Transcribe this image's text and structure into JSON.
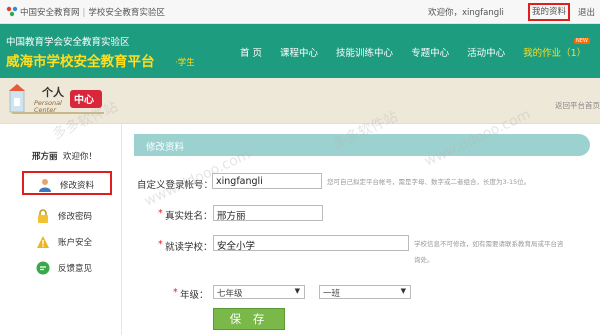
{
  "topbar": {
    "site_link": "中国安全教育网",
    "separator": "|",
    "zone_link": "学校安全教育实验区",
    "welcome": "欢迎你，xingfangli",
    "my_info": "我的资料",
    "logout": "退出"
  },
  "header": {
    "org": "中国教育学会安全教育实验区",
    "title": "威海市学校安全教育平台",
    "subtitle": "·学生",
    "nav": [
      {
        "label": "首  页"
      },
      {
        "label": "课程中心"
      },
      {
        "label": "技能训练中心"
      },
      {
        "label": "专题中心"
      },
      {
        "label": "活动中心"
      },
      {
        "label": "我的作业（1）"
      }
    ],
    "badge": "NEW"
  },
  "banner": {
    "personal_cn": "个人",
    "center_cn": "中心",
    "personal_en": "Personal Center",
    "return_link": "返回平台首页"
  },
  "sidebar": {
    "user_name": "邢方丽",
    "welcome": "欢迎你！",
    "items": [
      {
        "label": "修改资料",
        "icon": "user-icon"
      },
      {
        "label": "修改密码",
        "icon": "lock-icon"
      },
      {
        "label": "账户安全",
        "icon": "warning-icon"
      },
      {
        "label": "反馈意见",
        "icon": "feedback-icon"
      }
    ]
  },
  "panel": {
    "heading": "修改资料",
    "login_label": "自定义登录帐号：",
    "login_value": "xingfangli",
    "login_hint": "您可自己拟定平台帐号，需是字母、数字或二者组合，长度为3-15位。",
    "name_label": "真实姓名：",
    "name_value": "邢方丽",
    "school_label": "就读学校：",
    "school_value": "安全小学",
    "school_hint_1": "学校信息不可修改，如有需要请联系教育局或平台咨",
    "school_hint_2": "询处。",
    "grade_label": "年级：",
    "grade_value": "七年级",
    "class_value": "一班",
    "save_label": "保 存",
    "required_mark": "*"
  },
  "watermarks": [
    "多多软件站",
    "www.ddooo.com",
    "多多软件站",
    "www.ddooo.com"
  ],
  "colors": {
    "header_bg": "#1e9c80",
    "title": "#ffde1f",
    "stripe": "#9bd2d0",
    "highlight": "#e01e1e",
    "save_button": "#7ab84a"
  }
}
